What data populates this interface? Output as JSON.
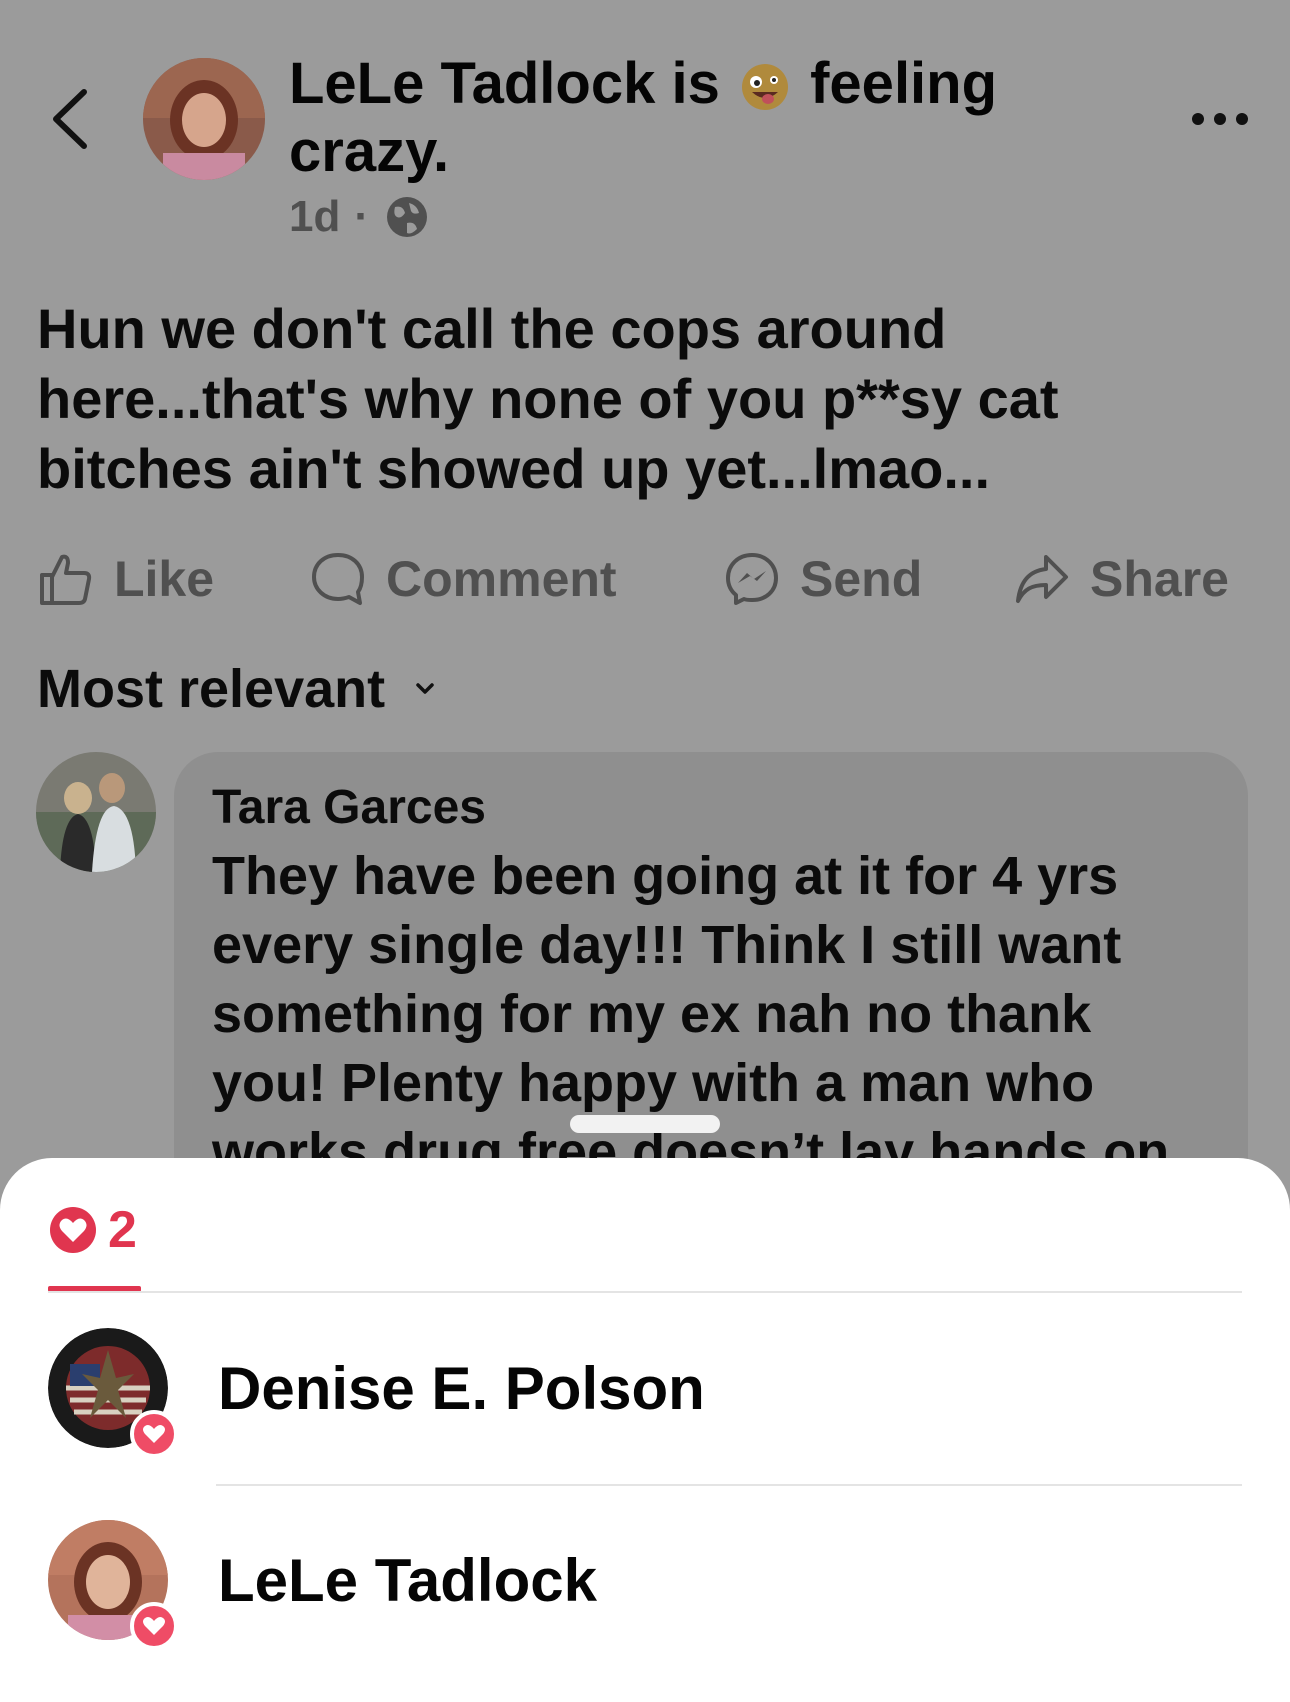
{
  "post": {
    "author": "LeLe Tadlock",
    "activity_prefix": "is",
    "activity_feeling": "feeling",
    "activity_state": "crazy.",
    "time": "1d",
    "separator": "·",
    "privacy_icon": "globe-icon",
    "body": "Hun we don't call the cops around here...that's why none of you p**sy cat bitches ain't showed up yet...lmao..."
  },
  "actions": {
    "like": "Like",
    "comment": "Comment",
    "send": "Send",
    "share": "Share"
  },
  "comments": {
    "sort_label": "Most relevant",
    "first": {
      "author": "Tara Garces",
      "text": "They have been going at it for 4 yrs every single day!!! Think I still want something for my ex nah no thank you! Plenty happy with a man who works drug free doesn’t lay hands on"
    }
  },
  "reactions_sheet": {
    "tab_count": "2",
    "tab_icon": "heart-icon",
    "accent_color": "#e0354f",
    "people": [
      {
        "name": "Denise E. Polson",
        "reaction": "love"
      },
      {
        "name": "LeLe Tadlock",
        "reaction": "love"
      }
    ]
  }
}
